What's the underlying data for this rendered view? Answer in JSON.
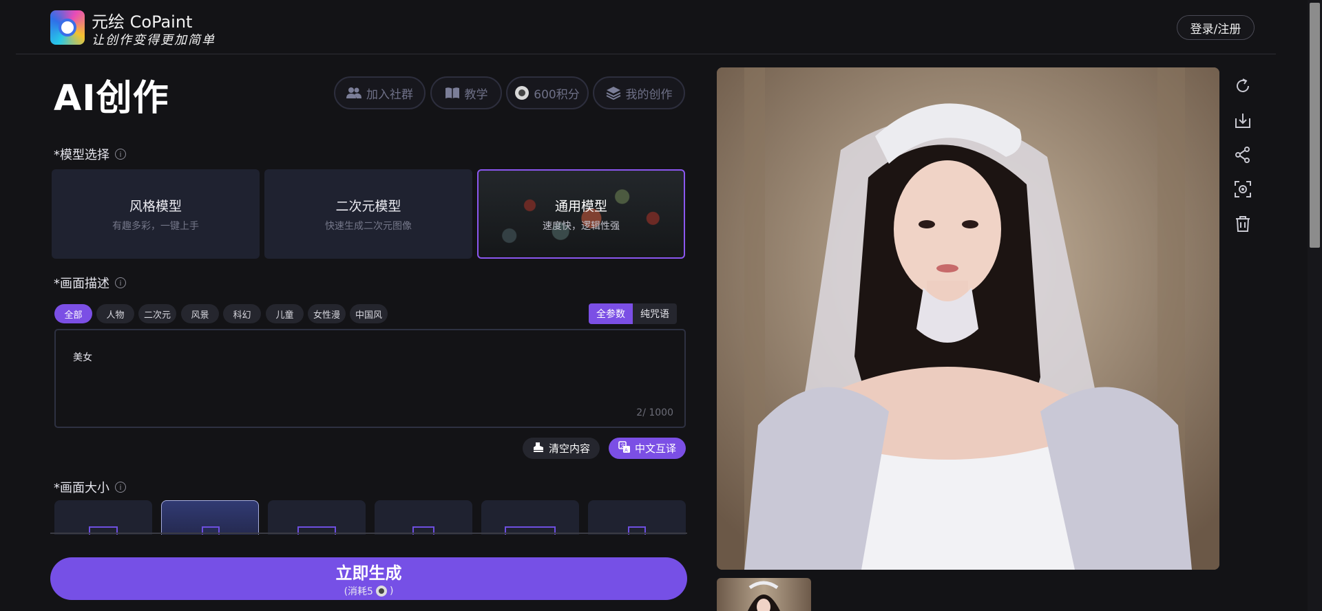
{
  "brand": {
    "name": "元绘 CoPaint",
    "slogan": "让创作变得更加简单"
  },
  "header": {
    "login_label": "登录/注册"
  },
  "page": {
    "title": "AI创作"
  },
  "top_actions": [
    {
      "label": "加入社群",
      "icon": "users-icon"
    },
    {
      "label": "教学",
      "icon": "book-icon"
    },
    {
      "label": "600积分",
      "icon": "coin-icon"
    },
    {
      "label": "我的创作",
      "icon": "layers-icon"
    }
  ],
  "model_section": {
    "label": "*模型选择",
    "cards": [
      {
        "title": "风格模型",
        "subtitle": "有趣多彩，一键上手",
        "selected": false
      },
      {
        "title": "二次元模型",
        "subtitle": "快速生成二次元图像",
        "selected": false
      },
      {
        "title": "通用模型",
        "subtitle": "速度快，逻辑性强",
        "selected": true
      }
    ]
  },
  "prompt_section": {
    "label": "*画面描述",
    "tags": [
      {
        "label": "全部",
        "active": true
      },
      {
        "label": "人物",
        "active": false
      },
      {
        "label": "二次元",
        "active": false
      },
      {
        "label": "风景",
        "active": false
      },
      {
        "label": "科幻",
        "active": false
      },
      {
        "label": "儿童",
        "active": false
      },
      {
        "label": "女性漫",
        "active": false
      },
      {
        "label": "中国风",
        "active": false
      }
    ],
    "modes": [
      {
        "label": "全参数",
        "active": true
      },
      {
        "label": "纯咒语",
        "active": false
      }
    ],
    "value": "美女",
    "counter": "2/ 1000",
    "clear_label": "清空内容",
    "translate_label": "中文互译"
  },
  "size_section": {
    "label": "*画面大小",
    "selected_index": 1
  },
  "generate": {
    "label": "立即生成",
    "cost_prefix": "(消耗5",
    "cost_suffix": ")"
  },
  "side_tools": [
    "refresh-icon",
    "download-icon",
    "share-icon",
    "scan-icon",
    "trash-icon"
  ],
  "colors": {
    "accent": "#7b4fe5",
    "background": "#131316",
    "card": "#1f2230"
  }
}
